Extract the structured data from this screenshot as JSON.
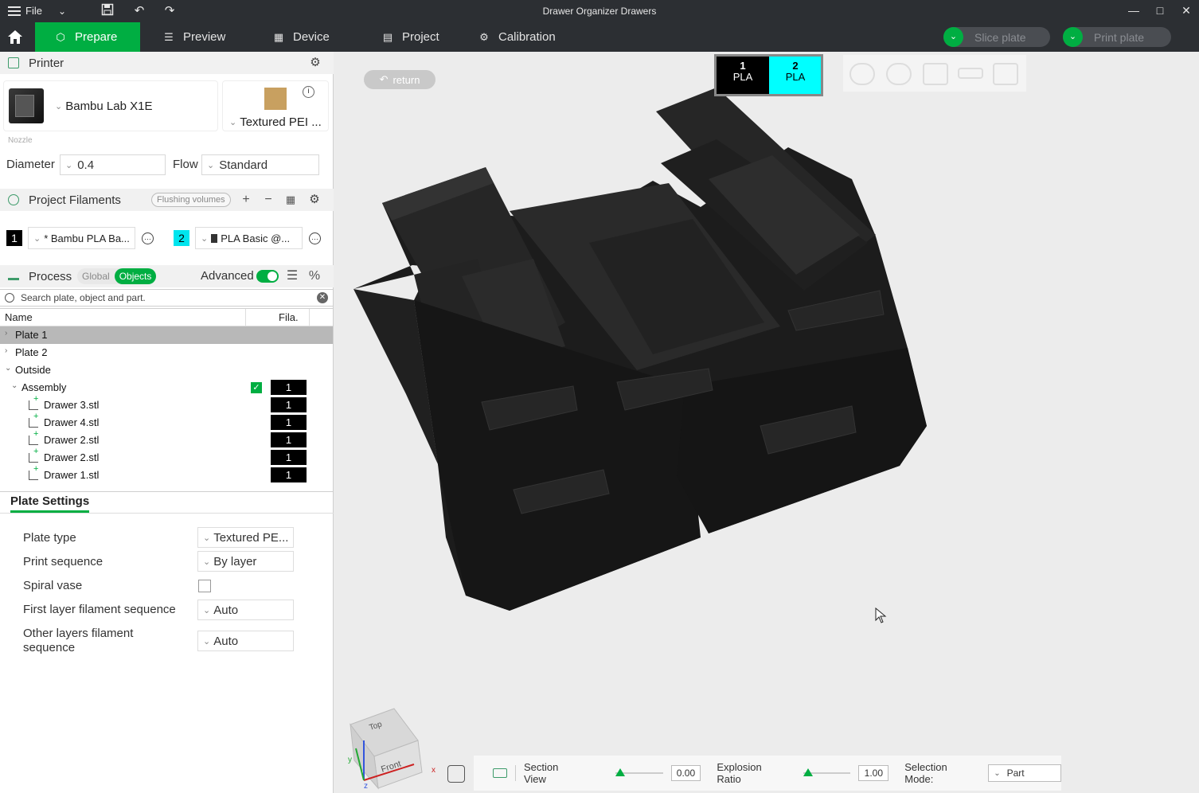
{
  "window": {
    "menu_label": "File",
    "title": "Drawer Organizer Drawers"
  },
  "nav": {
    "tabs": [
      {
        "label": "Prepare",
        "icon": "cube-icon",
        "active": true
      },
      {
        "label": "Preview",
        "icon": "layers-icon",
        "active": false
      },
      {
        "label": "Device",
        "icon": "device-icon",
        "active": false
      },
      {
        "label": "Project",
        "icon": "project-icon",
        "active": false
      },
      {
        "label": "Calibration",
        "icon": "calibration-icon",
        "active": false
      }
    ],
    "slice_label": "Slice plate",
    "print_label": "Print plate"
  },
  "printer": {
    "section_title": "Printer",
    "printer_name": "Bambu Lab X1E",
    "plate_name": "Textured PEI ...",
    "nozzle_label": "Nozzle",
    "diameter_label": "Diameter",
    "diameter_value": "0.4",
    "flow_label": "Flow",
    "flow_value": "Standard"
  },
  "filaments": {
    "section_title": "Project Filaments",
    "flushing_label": "Flushing volumes",
    "items": [
      {
        "num": "1",
        "name": "* Bambu PLA Ba...",
        "color": "#000000",
        "text_color": "#ffffff"
      },
      {
        "num": "2",
        "name": "PLA Basic @...",
        "color": "#00e5ee",
        "text_color": "#000000"
      }
    ]
  },
  "process": {
    "section_title": "Process",
    "seg_global": "Global",
    "seg_objects": "Objects",
    "advanced_label": "Advanced",
    "search_placeholder": "Search plate, object and part."
  },
  "tree": {
    "col_name": "Name",
    "col_fila": "Fila.",
    "rows": [
      {
        "label": "Plate 1",
        "indent": 0,
        "twisty": ">",
        "selected": true,
        "fil": ""
      },
      {
        "label": "Plate 2",
        "indent": 0,
        "twisty": ">",
        "selected": false,
        "fil": ""
      },
      {
        "label": "Outside",
        "indent": 0,
        "twisty": "v",
        "selected": false,
        "fil": ""
      },
      {
        "label": "Assembly",
        "indent": 1,
        "twisty": "v",
        "selected": false,
        "fil": "1",
        "checked": true
      },
      {
        "label": "Drawer 3.stl",
        "indent": 2,
        "twisty": "",
        "selected": false,
        "fil": "1",
        "part": true
      },
      {
        "label": "Drawer 4.stl",
        "indent": 2,
        "twisty": "",
        "selected": false,
        "fil": "1",
        "part": true
      },
      {
        "label": "Drawer 2.stl",
        "indent": 2,
        "twisty": "",
        "selected": false,
        "fil": "1",
        "part": true
      },
      {
        "label": "Drawer 2.stl",
        "indent": 2,
        "twisty": "",
        "selected": false,
        "fil": "1",
        "part": true
      },
      {
        "label": "Drawer 1.stl",
        "indent": 2,
        "twisty": "",
        "selected": false,
        "fil": "1",
        "part": true
      }
    ]
  },
  "plate_settings": {
    "tab_label": "Plate Settings",
    "plate_type_label": "Plate type",
    "plate_type_value": "Textured PE...",
    "print_sequence_label": "Print sequence",
    "print_sequence_value": "By layer",
    "spiral_vase_label": "Spiral vase",
    "first_layer_label": "First layer filament sequence",
    "first_layer_value": "Auto",
    "other_layers_label": "Other layers filament sequence",
    "other_layers_value": "Auto"
  },
  "viewport": {
    "return_label": "return",
    "filament_tabs": [
      {
        "num": "1",
        "type": "PLA",
        "color": "#000000",
        "text_color": "#ffffff"
      },
      {
        "num": "2",
        "type": "PLA",
        "color": "#00ffff",
        "text_color": "#000000"
      }
    ],
    "cube_top": "Top",
    "cube_front": "Front",
    "axis_x": "x",
    "axis_y": "y",
    "axis_z": "z"
  },
  "bottom_bar": {
    "section_view_label": "Section View",
    "section_value": "0.00",
    "explosion_label": "Explosion Ratio",
    "explosion_value": "1.00",
    "selection_label": "Selection Mode:",
    "selection_value": "Part"
  }
}
